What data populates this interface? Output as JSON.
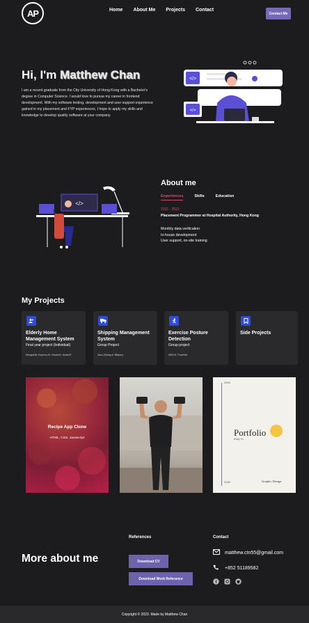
{
  "nav": {
    "logo_text": "AP",
    "links": [
      "Home",
      "About Me",
      "Projects",
      "Contact"
    ],
    "cta_label": "Contact Me",
    "accent": "#7569b8"
  },
  "hero": {
    "greeting": "Hi, I'm ",
    "name": "Matthew Chan",
    "intro": "I am a recent graduate from the City University of Hong Kong with a Bachelor's degree in Computer Science. I would love to pursue my career in frontend development. With my software testing, development and user support experience gained in my placement and FYP experiences, I hope to apply my skills and knowledge to develop quality software at your company."
  },
  "about": {
    "title": "About me",
    "tabs": [
      "Experiences",
      "Skills",
      "Education"
    ],
    "date": "2021 - 2022",
    "role": "Placement Programmer at Hospital Authority, Hong Kong",
    "duties": [
      "Monthly data verification",
      "In-house development",
      "User support, on-site training"
    ],
    "highlight": "#e8455f"
  },
  "projects": {
    "title": "My Projects",
    "cards": [
      {
        "title": "Elderly Home Management System",
        "subtitle": "Final year project (Individual)",
        "tech": "MongoDB, ExpressJS, ReactJS, NodeJS",
        "icon": "users-icon"
      },
      {
        "title": "Shipping Management System",
        "subtitle": "Group Project",
        "tech": "Java (Swing & JBdpac)",
        "icon": "truck-icon"
      },
      {
        "title": "Exercise Posture Detection",
        "subtitle": "Group project",
        "tech": "MiSUS, PoseNet",
        "icon": "running-icon"
      },
      {
        "title": "Side Projects",
        "subtitle": "",
        "tech": "",
        "icon": "bookmark-icon"
      }
    ],
    "icon_color": "#2f4cd8",
    "tiles": {
      "recipe_title": "Recipe App Clone",
      "recipe_sub": "HTML, CSS, Javascript",
      "portfolio_word": "Portfolio",
      "portfolio_small": "Graphic Design",
      "portfolio_year_top": "2020",
      "portfolio_year_bottom": "2030",
      "portfolio_sub": "Emily Yu"
    }
  },
  "more": {
    "title": "More about me",
    "references_title": "References",
    "download_cv": "Download CV",
    "download_ref": "Download Work Reference",
    "contact_title": "Contact",
    "email": "matthew.ctn55@gmail.com",
    "phone": "+852 51189582"
  },
  "footer": {
    "text": "Copyright © 2023. Made by Matthew Chan"
  }
}
